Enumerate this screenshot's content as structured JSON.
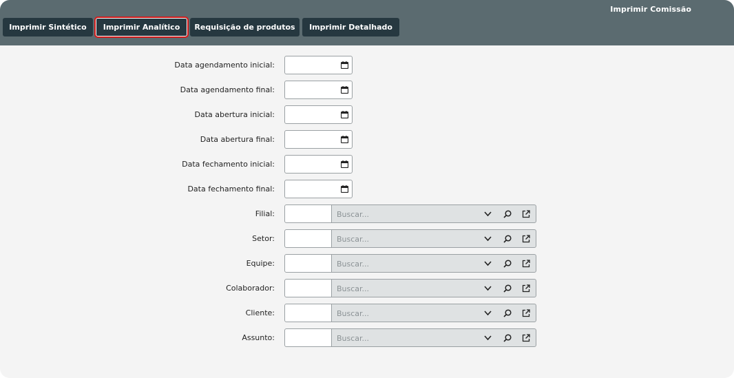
{
  "header": {
    "title": "Imprimir Comissão"
  },
  "tabs": [
    {
      "label": "Imprimir Sintético"
    },
    {
      "label": "Imprimir Analítico",
      "active": true
    },
    {
      "label": "Requisição de produtos"
    },
    {
      "label": "Imprimir Detalhado"
    }
  ],
  "dates": [
    {
      "label": "Data agendamento inicial:",
      "value": ""
    },
    {
      "label": "Data agendamento final:",
      "value": ""
    },
    {
      "label": "Data abertura inicial:",
      "value": ""
    },
    {
      "label": "Data abertura final:",
      "value": ""
    },
    {
      "label": "Data fechamento inicial:",
      "value": ""
    },
    {
      "label": "Data fechamento final:",
      "value": ""
    }
  ],
  "lookups": [
    {
      "label": "Filial:",
      "code": "",
      "placeholder": "Buscar..."
    },
    {
      "label": "Setor:",
      "code": "",
      "placeholder": "Buscar..."
    },
    {
      "label": "Equipe:",
      "code": "",
      "placeholder": "Buscar..."
    },
    {
      "label": "Colaborador:",
      "code": "",
      "placeholder": "Buscar..."
    },
    {
      "label": "Cliente:",
      "code": "",
      "placeholder": "Buscar..."
    },
    {
      "label": "Assunto:",
      "code": "",
      "placeholder": "Buscar..."
    }
  ],
  "icons": {
    "date": "calendar-icon",
    "dropdown": "chevron-down-icon",
    "search": "magnifier-icon",
    "open": "external-link-icon"
  },
  "colors": {
    "header_bg": "#5b6b70",
    "tab_bg": "#263840",
    "active_outline": "#d21b1b",
    "page_bg": "#f4f4f4"
  }
}
